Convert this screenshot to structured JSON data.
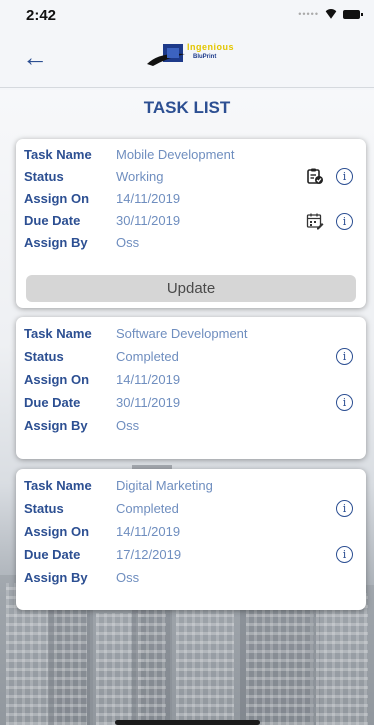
{
  "status_bar": {
    "time": "2:42"
  },
  "header": {
    "logo_line1": "Ingenious",
    "logo_line2": "BluPrint"
  },
  "page_title": "TASK LIST",
  "labels": {
    "task_name": "Task Name",
    "status": "Status",
    "assign_on": "Assign On",
    "due_date": "Due Date",
    "assign_by": "Assign By"
  },
  "tasks": [
    {
      "task_name": "Mobile Development",
      "status": "Working",
      "assign_on": "14/11/2019",
      "due_date": "30/11/2019",
      "assign_by": "Oss",
      "update_label": "Update"
    },
    {
      "task_name": "Software Development",
      "status": "Completed",
      "assign_on": "14/11/2019",
      "due_date": "30/11/2019",
      "assign_by": "Oss"
    },
    {
      "task_name": "Digital Marketing",
      "status": "Completed",
      "assign_on": "14/11/2019",
      "due_date": "17/12/2019",
      "assign_by": "Oss"
    }
  ],
  "icons": {
    "back": "arrow-left-icon",
    "info": "info-icon",
    "status_edit": "clipboard-check-icon",
    "calendar": "calendar-edit-icon"
  },
  "colors": {
    "primary": "#2c4f92",
    "value_text": "#6f8ebf",
    "button_bg": "#d6d6d6"
  }
}
